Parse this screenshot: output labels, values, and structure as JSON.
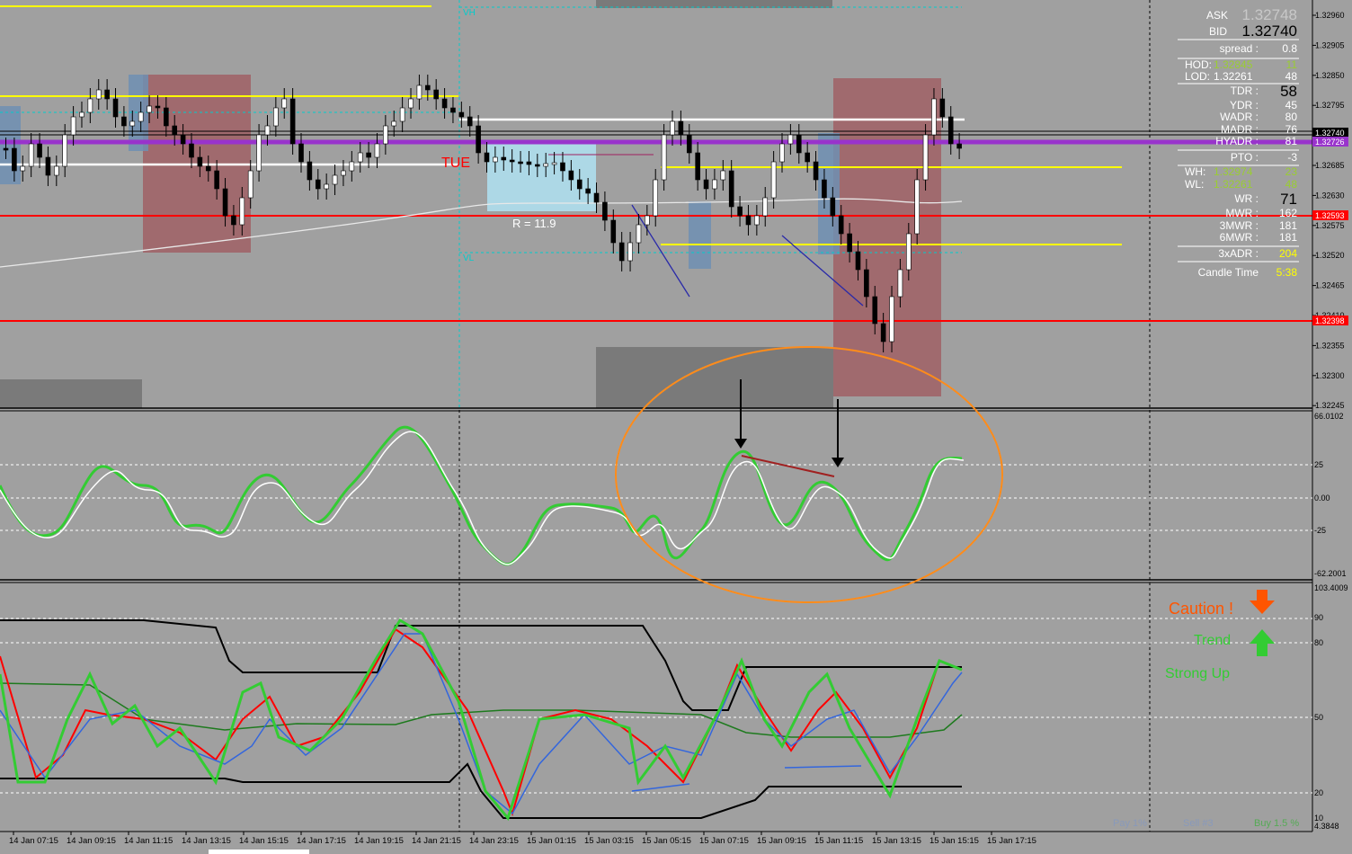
{
  "colors": {
    "background": "#a0a0a0",
    "bull_candle": "#ffffff",
    "bear_candle": "#000000",
    "support_red": "#ff0000",
    "yellow_level": "#ffff00",
    "white_level": "#ffffff",
    "purple_level": "#9933cc",
    "range_box": "#add8e6",
    "zone_red": "#a06a6e",
    "zone_blue": "#6f8fb3",
    "oscillator_green": "#33cc33",
    "oscillator_white": "#ffffff",
    "ellipse_orange": "#ff8c1a",
    "caution_orange": "#ff5500",
    "trend_green": "#33cc33"
  },
  "labels": {
    "session_tag": "TUE",
    "range": "R = 11.9",
    "vh": "VH",
    "vl": "VL"
  },
  "panel": {
    "ask_label": "ASK",
    "ask_value": "1.32748",
    "bid_label": "BID",
    "bid_value": "1.32740",
    "rows": [
      {
        "label": "spread :",
        "value": "0.8",
        "vcolor": "#ffffff"
      },
      {
        "label": "HOD:",
        "mid": "1.32845",
        "value": "11",
        "mcolor": "#9acd32",
        "vcolor": "#9acd32"
      },
      {
        "label": "LOD:",
        "mid": "1.32261",
        "value": "48",
        "mcolor": "#ffffff",
        "vcolor": "#ffffff"
      },
      {
        "label": "TDR :",
        "value": "58",
        "vcolor": "#000000",
        "big": true
      },
      {
        "label": "YDR :",
        "value": "45",
        "vcolor": "#ffffff"
      },
      {
        "label": "WADR :",
        "value": "80",
        "vcolor": "#ffffff"
      },
      {
        "label": "MADR :",
        "value": "76",
        "vcolor": "#ffffff"
      },
      {
        "label": "HYADR :",
        "value": "81",
        "vcolor": "#ffffff"
      },
      {
        "label": "PTO :",
        "value": "-3",
        "vcolor": "#ffffff"
      },
      {
        "label": "WH:",
        "mid": "1.32974",
        "value": "23",
        "mcolor": "#9acd32",
        "vcolor": "#9acd32"
      },
      {
        "label": "WL:",
        "mid": "1.32261",
        "value": "48",
        "mcolor": "#9acd32",
        "vcolor": "#9acd32"
      },
      {
        "label": "WR :",
        "value": "71",
        "vcolor": "#000000",
        "big": true
      },
      {
        "label": "MWR :",
        "value": "162",
        "vcolor": "#ffffff"
      },
      {
        "label": "3MWR :",
        "value": "181",
        "vcolor": "#ffffff"
      },
      {
        "label": "6MWR :",
        "value": "181",
        "vcolor": "#ffffff"
      },
      {
        "label": "3xADR :",
        "value": "204",
        "vcolor": "#ffff00"
      },
      {
        "label": "Candle Time",
        "value": "5:38",
        "vcolor": "#ffff00"
      }
    ]
  },
  "price_axis": [
    "1.32960",
    "1.32905",
    "1.32850",
    "1.32795",
    "1.32740",
    "1.32685",
    "1.32630",
    "1.32575",
    "1.32520",
    "1.32465",
    "1.32410",
    "1.32355",
    "1.32300",
    "1.32245"
  ],
  "price_tags": [
    {
      "text": "1.32740",
      "bg": "#000000",
      "fg": "#ffffff"
    },
    {
      "text": "1.32726",
      "bg": "#9933cc",
      "fg": "#ffffff"
    },
    {
      "text": "1.32593",
      "bg": "#ff0000",
      "fg": "#ffffff"
    },
    {
      "text": "1.32398",
      "bg": "#ff0000",
      "fg": "#ffffff"
    }
  ],
  "osc_axis": [
    "66.0102",
    "25",
    "0.00",
    "-25",
    "-62.2001"
  ],
  "stoch_axis": [
    "103.4009",
    "90",
    "80",
    "50",
    "20",
    "10",
    "4.3848"
  ],
  "time_axis": [
    "14 Jan 07:15",
    "14 Jan 09:15",
    "14 Jan 11:15",
    "14 Jan 13:15",
    "14 Jan 15:15",
    "14 Jan 17:15",
    "14 Jan 19:15",
    "14 Jan 21:15",
    "14 Jan 23:15",
    "15 Jan 01:15",
    "15 Jan 03:15",
    "15 Jan 05:15",
    "15 Jan 07:15",
    "15 Jan 09:15",
    "15 Jan 11:15",
    "15 Jan 13:15",
    "15 Jan 15:15",
    "15 Jan 17:15"
  ],
  "signals": {
    "caution": "Caution !",
    "trend": "Trend",
    "strong": "Strong Up"
  },
  "bottom_status": {
    "a": "Pay 1%",
    "b": "Sell #3",
    "c": "Buy 1.5 %"
  }
}
